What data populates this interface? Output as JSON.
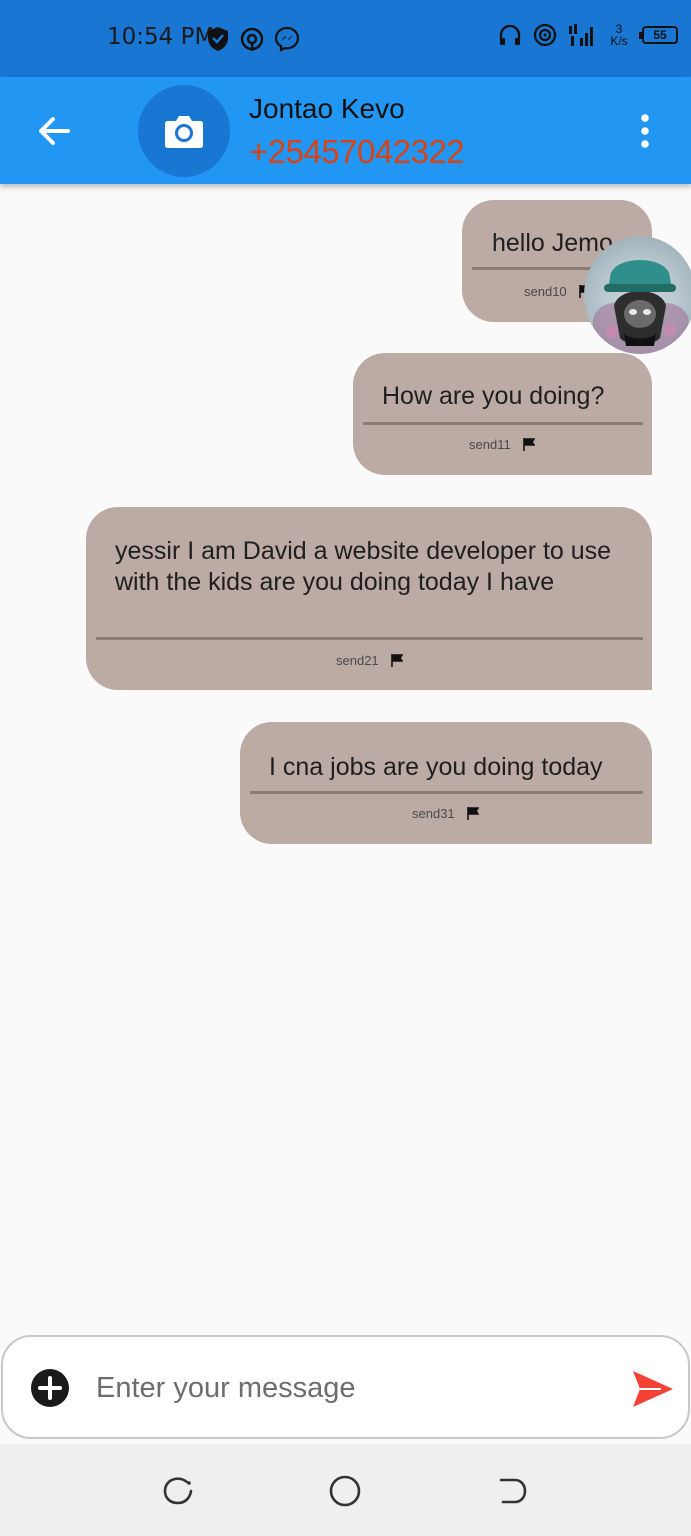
{
  "status_bar": {
    "time": "10:54 PM",
    "speed_value": "3",
    "speed_unit": "K/s",
    "battery": "55",
    "icons": [
      "shield-icon",
      "hotspot-icon",
      "messenger-icon",
      "headset-icon",
      "wifi-icon",
      "signal-icon",
      "battery-icon"
    ]
  },
  "header": {
    "name": "Jontao Kevo",
    "phone": "+25457042322",
    "icons": [
      "back-arrow-icon",
      "camera-icon",
      "more-vert-icon"
    ]
  },
  "messages": [
    {
      "text": "hello Jemo",
      "meta": "send10"
    },
    {
      "text": "How are you doing?",
      "meta": "send11"
    },
    {
      "text": "yessir I am David a website developer to use with the kids are you doing today I have",
      "meta": "send21"
    },
    {
      "text": "I cna jobs are you doing today",
      "meta": "send31"
    }
  ],
  "input": {
    "placeholder": "Enter your message",
    "icons": [
      "add-circle-icon",
      "send-icon"
    ]
  },
  "nav": {
    "icons": [
      "recents-icon",
      "home-icon",
      "back-icon"
    ]
  },
  "colors": {
    "status_bar": "#1976d2",
    "app_bar": "#2196f3",
    "bubble": "#bcaaa4",
    "phone": "#d84315",
    "send": "#f44336"
  }
}
